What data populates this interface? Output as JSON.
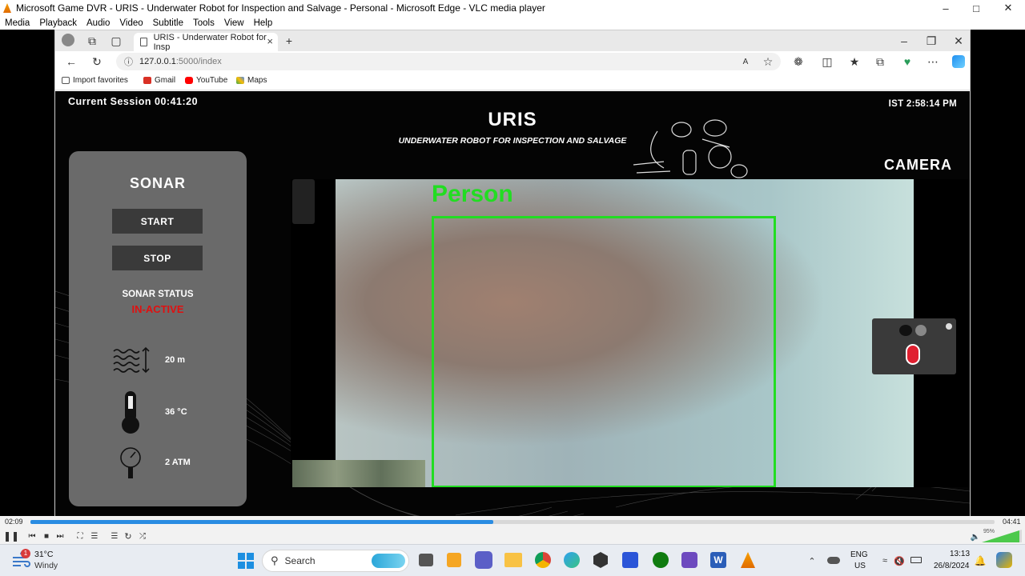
{
  "vlc": {
    "title": "Microsoft Game DVR - URIS - Underwater Robot for Inspection and Salvage - Personal - Microsoft Edge - VLC media player",
    "menu": [
      "Media",
      "Playback",
      "Audio",
      "Video",
      "Subtitle",
      "Tools",
      "View",
      "Help"
    ],
    "time_elapsed": "02:09",
    "time_total": "04:41",
    "progress_fraction": 0.48,
    "volume": "95%"
  },
  "browser": {
    "tab_title": "URIS - Underwater Robot for Insp",
    "url_host": "127.0.0.1",
    "url_path": ":5000/index",
    "favorites": [
      "Import favorites",
      "Gmail",
      "YouTube",
      "Maps"
    ]
  },
  "page": {
    "session": "Current Session 00:41:20",
    "ist": "IST 2:58:14 PM",
    "title": "URIS",
    "subtitle": "UNDERWATER ROBOT FOR INSPECTION AND SALVAGE",
    "camera_title": "CAMERA",
    "sonar": {
      "title": "SONAR",
      "start": "START",
      "stop": "STOP",
      "status_label": "SONAR STATUS",
      "status_value": "IN-ACTIVE"
    },
    "metrics": {
      "depth": "20 m",
      "temp": "36 °C",
      "pressure": "2 ATM"
    },
    "detection_label": "Person"
  },
  "taskbar": {
    "weather_temp": "31°C",
    "weather_desc": "Windy",
    "weather_badge": "1",
    "search": "Search",
    "lang": "ENG",
    "region": "US",
    "time": "13:13",
    "date": "26/8/2024"
  }
}
